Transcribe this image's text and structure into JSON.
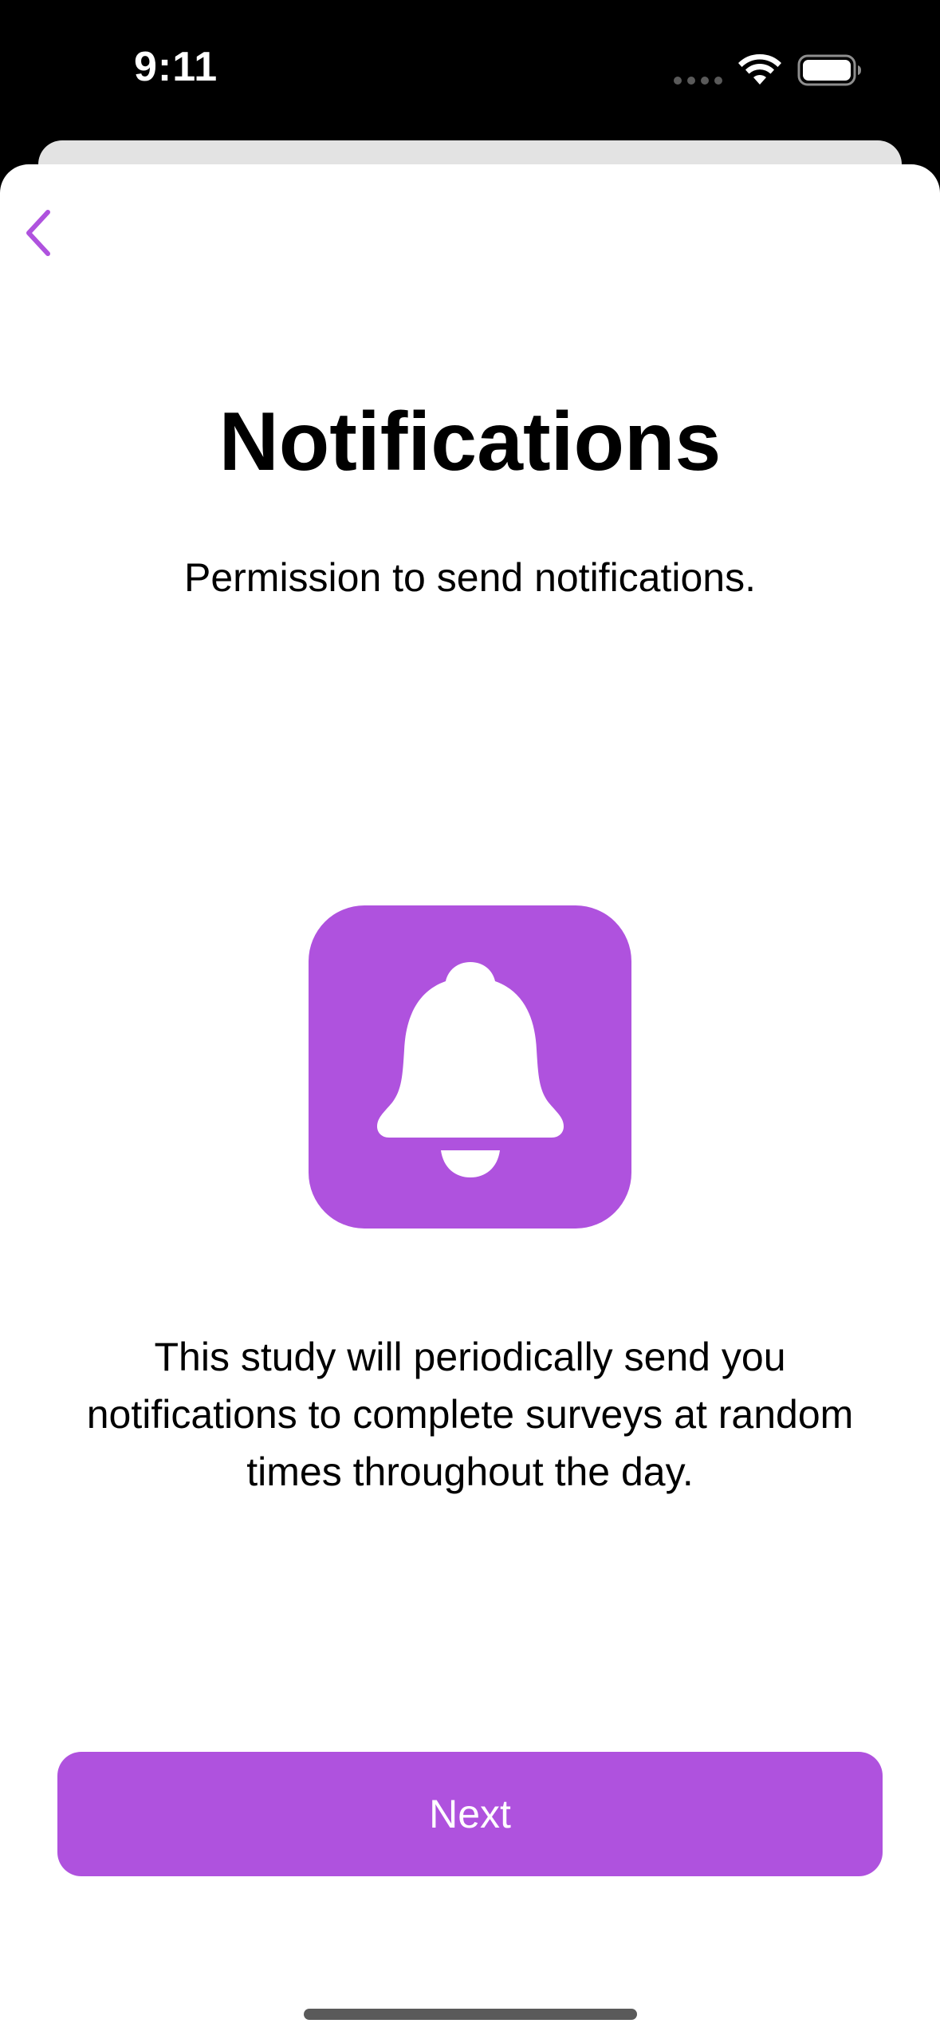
{
  "status_bar": {
    "time": "9:11"
  },
  "screen": {
    "title": "Notifications",
    "subtitle": "Permission to send notifications.",
    "description": "This study will periodically send you notifications to complete surveys at random times throughout the day.",
    "next_label": "Next"
  },
  "icons": {
    "back": "chevron-left-icon",
    "illustration": "bell-icon",
    "wifi": "wifi-icon",
    "battery": "battery-icon"
  },
  "colors": {
    "accent": "#af52de",
    "background": "#ffffff",
    "status_bar": "#000000"
  }
}
